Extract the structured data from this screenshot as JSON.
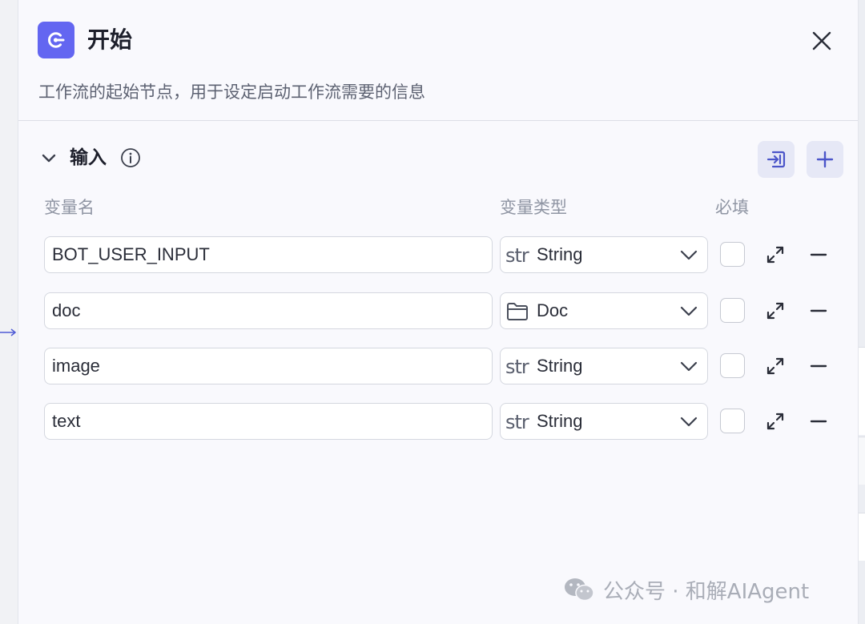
{
  "panel": {
    "title": "开始",
    "description": "工作流的起始节点，用于设定启动工作流需要的信息",
    "accent_color": "#6366f1"
  },
  "input_section": {
    "title": "输入",
    "columns": {
      "name": "变量名",
      "type": "变量类型",
      "required": "必填"
    },
    "variables": [
      {
        "name": "BOT_USER_INPUT",
        "type_icon": "str",
        "type": "String",
        "required": false
      },
      {
        "name": "doc",
        "type_icon": "folder-icon",
        "type": "Doc",
        "required": false
      },
      {
        "name": "image",
        "type_icon": "str",
        "type": "String",
        "required": false
      },
      {
        "name": "text",
        "type_icon": "str",
        "type": "String",
        "required": false
      }
    ]
  },
  "icons": {
    "node": "start-node-icon",
    "close": "close-icon",
    "collapse": "chevron-down-icon",
    "info": "info-icon",
    "import": "import-icon",
    "add": "plus-icon",
    "expand": "expand-icon",
    "remove": "minus-icon"
  },
  "watermark": {
    "text": "公众号 · 和解AIAgent"
  }
}
